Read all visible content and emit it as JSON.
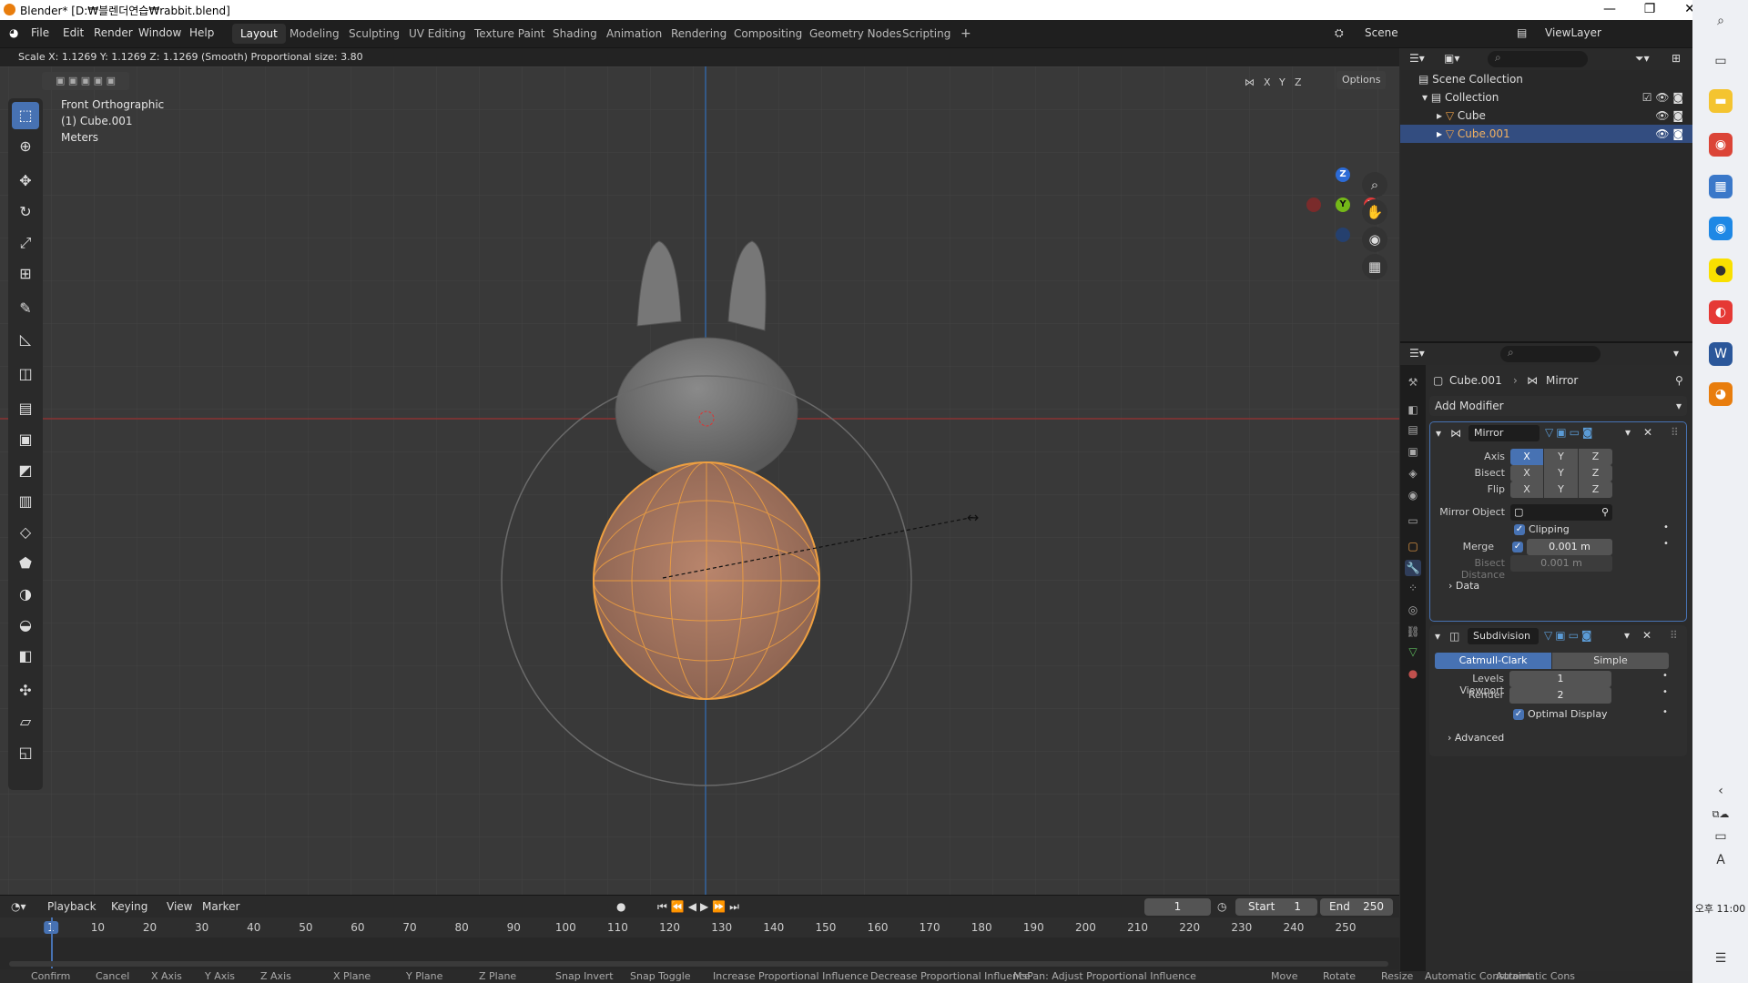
{
  "window": {
    "title": "Blender* [D:₩블렌더연습₩rabbit.blend]"
  },
  "menu": [
    "File",
    "Edit",
    "Render",
    "Window",
    "Help"
  ],
  "workspaces": [
    "Layout",
    "Modeling",
    "Sculpting",
    "UV Editing",
    "Texture Paint",
    "Shading",
    "Animation",
    "Rendering",
    "Compositing",
    "Geometry Nodes",
    "Scripting",
    "+"
  ],
  "scene": "Scene",
  "view_layer": "ViewLayer",
  "operator_status": "Scale X: 1.1269   Y: 1.1269  Z: 1.1269 (Smooth) Proportional size: 3.80",
  "viewport": {
    "view": "Front Orthographic",
    "object": "(1) Cube.001",
    "units": "Meters",
    "options": "Options",
    "xyz": [
      "X",
      "Y",
      "Z"
    ]
  },
  "gizmo": {
    "z": "Z",
    "y": "Y",
    "x": "X"
  },
  "outliner": {
    "scene_collection": "Scene Collection",
    "collection": "Collection",
    "items": [
      "Cube",
      "Cube.001"
    ]
  },
  "properties": {
    "breadcrumb_object": "Cube.001",
    "breadcrumb_modifier": "Mirror",
    "add_modifier": "Add Modifier",
    "mirror": {
      "name": "Mirror",
      "axis_label": "Axis",
      "bisect_label": "Bisect",
      "flip_label": "Flip",
      "axes": [
        "X",
        "Y",
        "Z"
      ],
      "mirror_object_label": "Mirror Object",
      "clipping": "Clipping",
      "merge_label": "Merge",
      "merge_value": "0.001 m",
      "bisect_distance_label": "Bisect Distance",
      "bisect_distance_value": "0.001 m",
      "data": "Data"
    },
    "subdivision": {
      "name": "Subdivision",
      "catmull": "Catmull-Clark",
      "simple": "Simple",
      "levels_label": "Levels Viewport",
      "levels_value": "1",
      "render_label": "Render",
      "render_value": "2",
      "optimal": "Optimal Display",
      "advanced": "Advanced"
    }
  },
  "timeline": {
    "playback": "Playback",
    "keying": "Keying",
    "view": "View",
    "marker": "Marker",
    "current_frame": "1",
    "start_label": "Start",
    "start": "1",
    "end_label": "End",
    "end": "250",
    "ruler": [
      "1",
      "10",
      "20",
      "30",
      "40",
      "50",
      "60",
      "70",
      "80",
      "90",
      "100",
      "110",
      "120",
      "130",
      "140",
      "150",
      "160",
      "170",
      "180",
      "190",
      "200",
      "210",
      "220",
      "230",
      "240",
      "250"
    ]
  },
  "statusbar": [
    "Confirm",
    "Cancel",
    "X Axis",
    "Y Axis",
    "Z Axis",
    "X Plane",
    "Y Plane",
    "Z Plane",
    "Snap Invert",
    "Snap Toggle",
    "Increase Proportional Influence",
    "Decrease Proportional Influence",
    "MsPan: Adjust Proportional Influence",
    "Move",
    "Rotate",
    "Resize",
    "Automatic Constraint",
    "Automatic Cons"
  ],
  "taskbar": {
    "time": "오후 11:00",
    "ime": "A"
  },
  "colors": {
    "accent": "#4772b3",
    "selected_orange": "#f0a040",
    "bg": "#393939"
  }
}
